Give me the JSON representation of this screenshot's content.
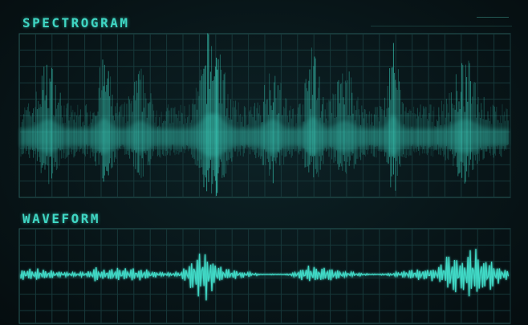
{
  "spectrogram": {
    "title": "SPECTROGRAM"
  },
  "waveform": {
    "title": "WAVEFORM"
  },
  "colors": {
    "accent": "#3fd6c3",
    "grid": "#1d3a3d",
    "background": "#081417"
  }
}
